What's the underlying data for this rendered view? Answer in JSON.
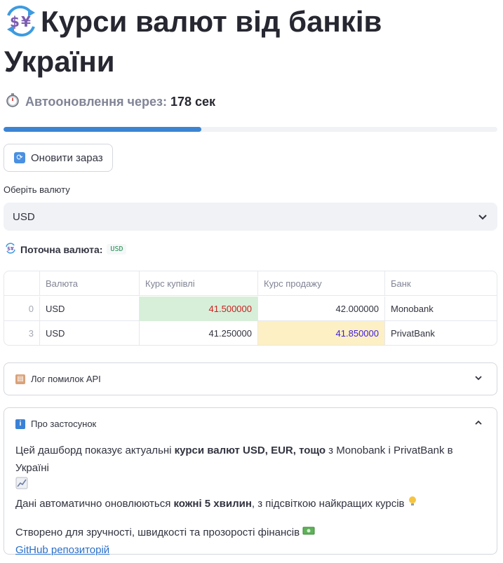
{
  "header": {
    "title_line1": "Курси валют від банків",
    "title_line2": "України"
  },
  "countdown": {
    "label": "Автооновлення через:",
    "value": "178 сек",
    "progress_fraction": 0.4
  },
  "refresh_button": {
    "label": "Оновити зараз"
  },
  "currency_select": {
    "label": "Оберіть валюту",
    "selected": "USD"
  },
  "current_currency": {
    "label": "Поточна валюта:",
    "code": "USD"
  },
  "rates_table": {
    "columns": [
      "",
      "Валюта",
      "Курс купівлі",
      "Курс продажу",
      "Банк"
    ],
    "rows": [
      {
        "index": "0",
        "currency": "USD",
        "buy": "41.500000",
        "sell": "42.000000",
        "bank": "Monobank",
        "buy_best": true,
        "sell_best": false
      },
      {
        "index": "3",
        "currency": "USD",
        "buy": "41.250000",
        "sell": "41.850000",
        "bank": "PrivatBank",
        "buy_best": false,
        "sell_best": true
      }
    ]
  },
  "error_log": {
    "label": "Лог помилок API",
    "expanded": false
  },
  "about": {
    "label": "Про застосунок",
    "expanded": true,
    "p1_pre": "Цей дашборд показує актуальні ",
    "p1_bold": "курси валют USD, EUR, тощо",
    "p1_post": " з Monobank і PrivatBank в Україні",
    "p2_pre": "Дані автоматично оновлюються ",
    "p2_bold": "кожні 5 хвилин",
    "p2_post": ", з підсвіткою найкращих курсів",
    "p3": "Створено для зручності, швидкості та прозорості фінансів",
    "link_text": "GitHub репозиторій"
  },
  "colors": {
    "accent": "#3c84d3",
    "best_buy_bg": "#d7efd9",
    "best_buy_text": "#cc1f1f",
    "best_sell_bg": "#fdf0c4",
    "best_sell_text": "#3d1ee0"
  }
}
